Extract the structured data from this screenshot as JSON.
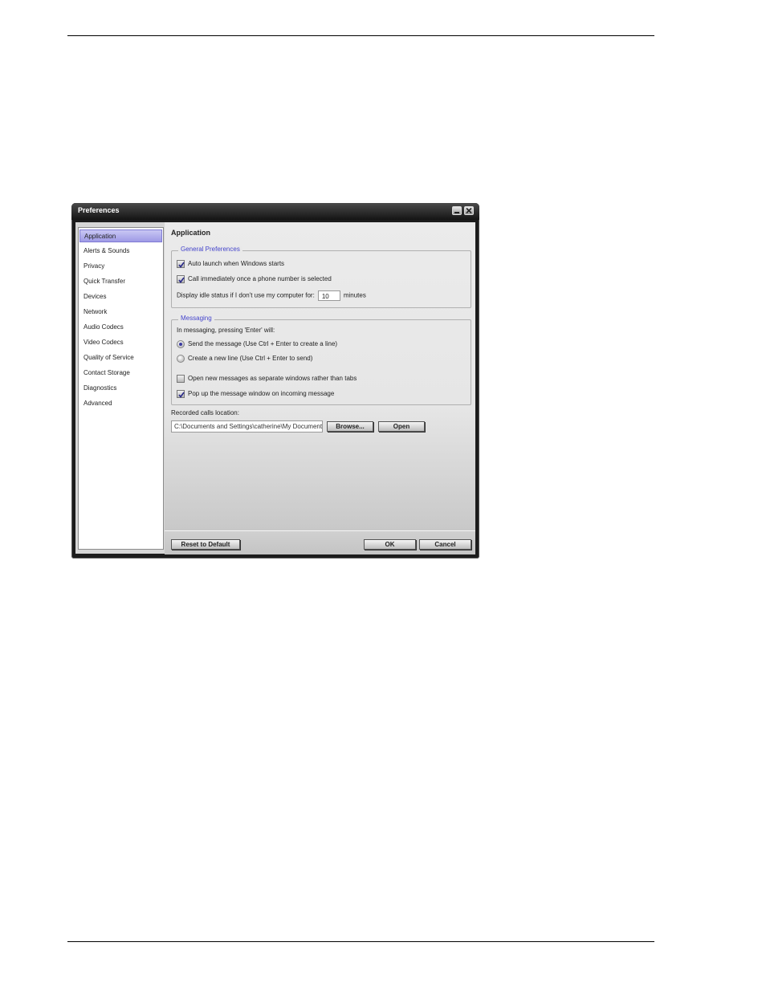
{
  "window": {
    "title": "Preferences"
  },
  "sidebar": {
    "items": [
      {
        "label": "Application",
        "active": true
      },
      {
        "label": "Alerts & Sounds"
      },
      {
        "label": "Privacy"
      },
      {
        "label": "Quick Transfer"
      },
      {
        "label": "Devices"
      },
      {
        "label": "Network"
      },
      {
        "label": "Audio Codecs"
      },
      {
        "label": "Video Codecs"
      },
      {
        "label": "Quality of Service"
      },
      {
        "label": "Contact Storage"
      },
      {
        "label": "Diagnostics"
      },
      {
        "label": "Advanced"
      }
    ]
  },
  "content": {
    "title": "Application",
    "general": {
      "legend": "General Preferences",
      "auto_launch": {
        "label": "Auto launch when Windows starts",
        "checked": true
      },
      "call_immediately": {
        "label": "Call immediately once a phone number is selected",
        "checked": true
      },
      "idle_label": "Display idle status if I don't use my computer for:",
      "idle_value": "10",
      "idle_unit": "minutes"
    },
    "messaging": {
      "legend": "Messaging",
      "enter_label": "In messaging, pressing 'Enter' will:",
      "send_message": {
        "label": "Send the message (Use Ctrl + Enter to create a line)",
        "selected": true
      },
      "new_line": {
        "label": "Create a new line (Use Ctrl + Enter to send)",
        "selected": false
      },
      "separate_windows": {
        "label": "Open new messages as separate windows rather than tabs",
        "checked": false
      },
      "popup": {
        "label": "Pop up the message window on incoming message",
        "checked": true
      }
    },
    "recorded": {
      "label": "Recorded calls location:",
      "path": "C:\\Documents and Settings\\catherine\\My Documents",
      "browse_label": "Browse...",
      "open_label": "Open"
    }
  },
  "footer": {
    "reset_label": "Reset to Default",
    "ok_label": "OK",
    "cancel_label": "Cancel"
  }
}
